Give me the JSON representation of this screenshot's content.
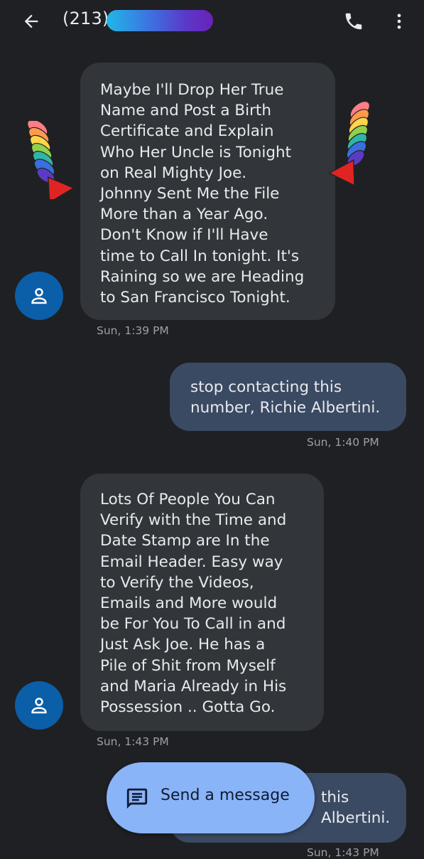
{
  "header": {
    "title": "(213)",
    "back_icon": "arrow-left-icon",
    "call_icon": "phone-icon",
    "more_icon": "more-vertical-icon"
  },
  "messages": [
    {
      "direction": "incoming",
      "text": "Maybe I'll Drop Her True\nName and Post a Birth\nCertificate and Explain\nWho Her Uncle is Tonight\non Real Mighty Joe.\nJohnny Sent Me the File\nMore than a Year Ago.\nDon't Know if I'll Have\ntime to Call In tonight. It's\nRaining so we are Heading\nto San Francisco Tonight.",
      "time": "Sun, 1:39 PM"
    },
    {
      "direction": "outgoing",
      "text": "stop contacting this\nnumber, Richie Albertini.",
      "time": "Sun, 1:40 PM"
    },
    {
      "direction": "incoming",
      "text": "Lots Of People You Can\nVerify with the Time and\nDate Stamp are In the\nEmail Header. Easy way\nto Verify the Videos,\nEmails and More would\nbe For You To Call in and\nJust Ask Joe. He has a\nPile of Shit from Myself\nand Maria Already in His\nPossession .. Gotta Go.",
      "time": "Sun, 1:43 PM"
    },
    {
      "direction": "outgoing",
      "text": "this\nAlbertini.",
      "time": "Sun, 1:43 PM"
    }
  ],
  "compose": {
    "label": "Send a message",
    "icon": "message-icon"
  },
  "colors": {
    "background": "#1f2023",
    "incoming_bubble": "#323539",
    "outgoing_bubble": "#3b4a63",
    "avatar": "#0b5ea8",
    "fab": "#8ab4f8"
  }
}
